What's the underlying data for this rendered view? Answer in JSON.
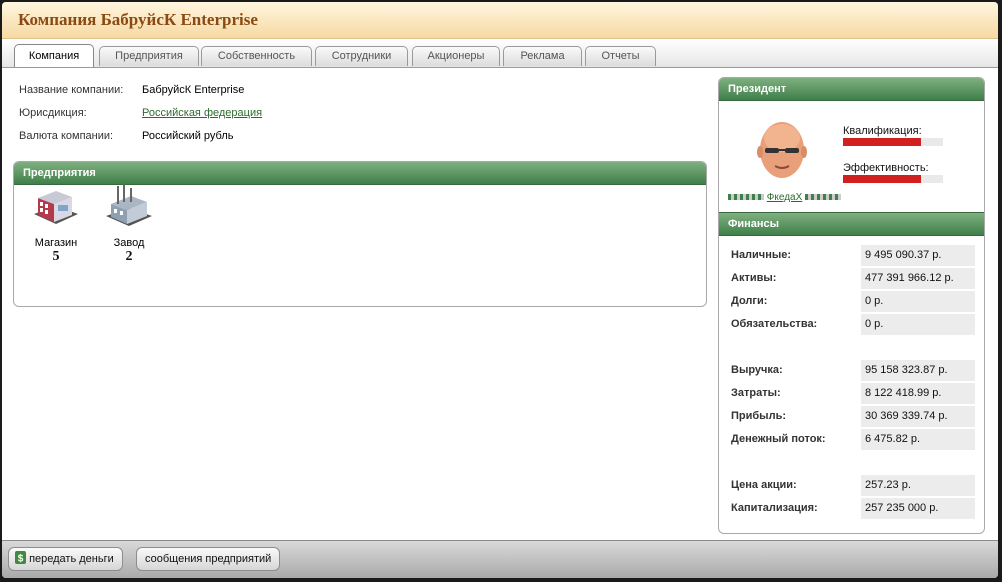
{
  "title": "Компания БабруйсК Enterprise",
  "tabs": [
    "Компания",
    "Предприятия",
    "Собственность",
    "Сотрудники",
    "Акционеры",
    "Реклама",
    "Отчеты"
  ],
  "company": {
    "name_label": "Название компании:",
    "name_value": "БабруйсК Enterprise",
    "jurisdiction_label": "Юрисдикция:",
    "jurisdiction_value": "Российская федерация",
    "currency_label": "Валюта компании:",
    "currency_value": "Российский рубль"
  },
  "enterprises": {
    "header": "Предприятия",
    "items": [
      {
        "label": "Магазин",
        "count": "5",
        "icon": "store-icon"
      },
      {
        "label": "Завод",
        "count": "2",
        "icon": "factory-icon"
      }
    ]
  },
  "president": {
    "header": "Президент",
    "qualification_label": "Квалификация:",
    "qualification_level": 0.78,
    "efficiency_label": "Эффективность:",
    "efficiency_level": 0.78,
    "name": "ФкедаХ",
    "avatar_icon": "avatar-icon"
  },
  "finance": {
    "header": "Финансы",
    "groups": [
      [
        {
          "label": "Наличные:",
          "value": "9 495 090.37 р."
        },
        {
          "label": "Активы:",
          "value": "477 391 966.12 р."
        },
        {
          "label": "Долги:",
          "value": "0 р."
        },
        {
          "label": "Обязательства:",
          "value": "0 р."
        }
      ],
      [
        {
          "label": "Выручка:",
          "value": "95 158 323.87 р."
        },
        {
          "label": "Затраты:",
          "value": "8 122 418.99 р."
        },
        {
          "label": "Прибыль:",
          "value": "30 369 339.74 р."
        },
        {
          "label": "Денежный поток:",
          "value": "6 475.82 р."
        }
      ],
      [
        {
          "label": "Цена акции:",
          "value": "257.23 р."
        },
        {
          "label": "Капитализация:",
          "value": "257 235 000 р."
        }
      ]
    ]
  },
  "bottom": {
    "transfer_label": "передать деньги",
    "messages_label": "сообщения предприятий"
  },
  "colors": {
    "title": "#8b4a13",
    "panel_header": "#4f8a55",
    "bar": "#d02020",
    "link": "#2e6b2e"
  }
}
